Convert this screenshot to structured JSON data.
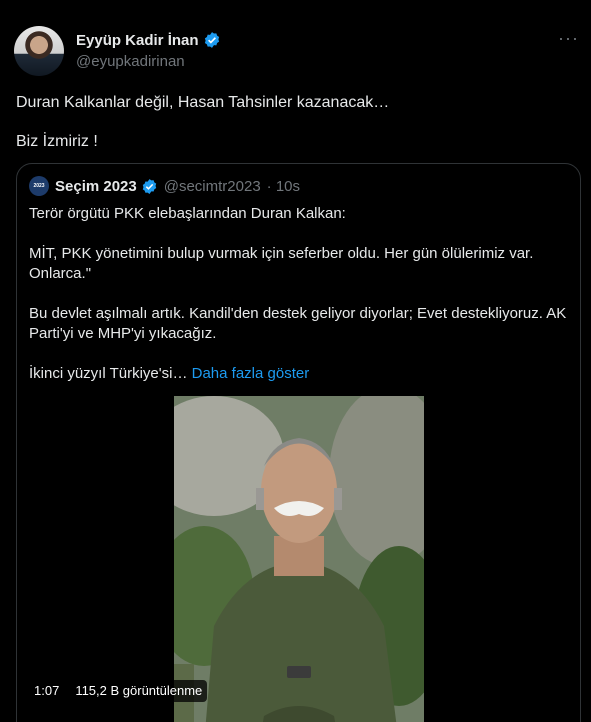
{
  "author": {
    "name": "Eyyüp Kadir İnan",
    "handle": "@eyupkadirinan"
  },
  "more_label": "···",
  "tweet": {
    "line1": "Duran Kalkanlar değil, Hasan Tahsinler kazanacak…",
    "line2": "Biz İzmiriz !"
  },
  "quote": {
    "avatar_text": "2023",
    "name": "Seçim 2023",
    "handle": "@secimtr2023",
    "time": "· 10s",
    "paragraphs": [
      "Terör örgütü PKK elebaşlarından Duran Kalkan:",
      "MİT, PKK yönetimini bulup vurmak için seferber oldu. Her gün ölülerimiz var. Onlarca.\"",
      "Bu devlet aşılmalı artık. Kandil'den destek geliyor diyorlar; Evet destekliyoruz. AK Parti'yi ve MHP'yi yıkacağız."
    ],
    "last_line": "İkinci yüzyıl Türkiye'si…",
    "show_more": "Daha fazla göster",
    "video": {
      "duration": "1:07",
      "views": "115,2 B görüntülenme"
    }
  },
  "colors": {
    "background": "#000000",
    "text": "#e7e9ea",
    "secondary": "#71767b",
    "accent": "#1d9bf0",
    "border": "#2f3336"
  }
}
